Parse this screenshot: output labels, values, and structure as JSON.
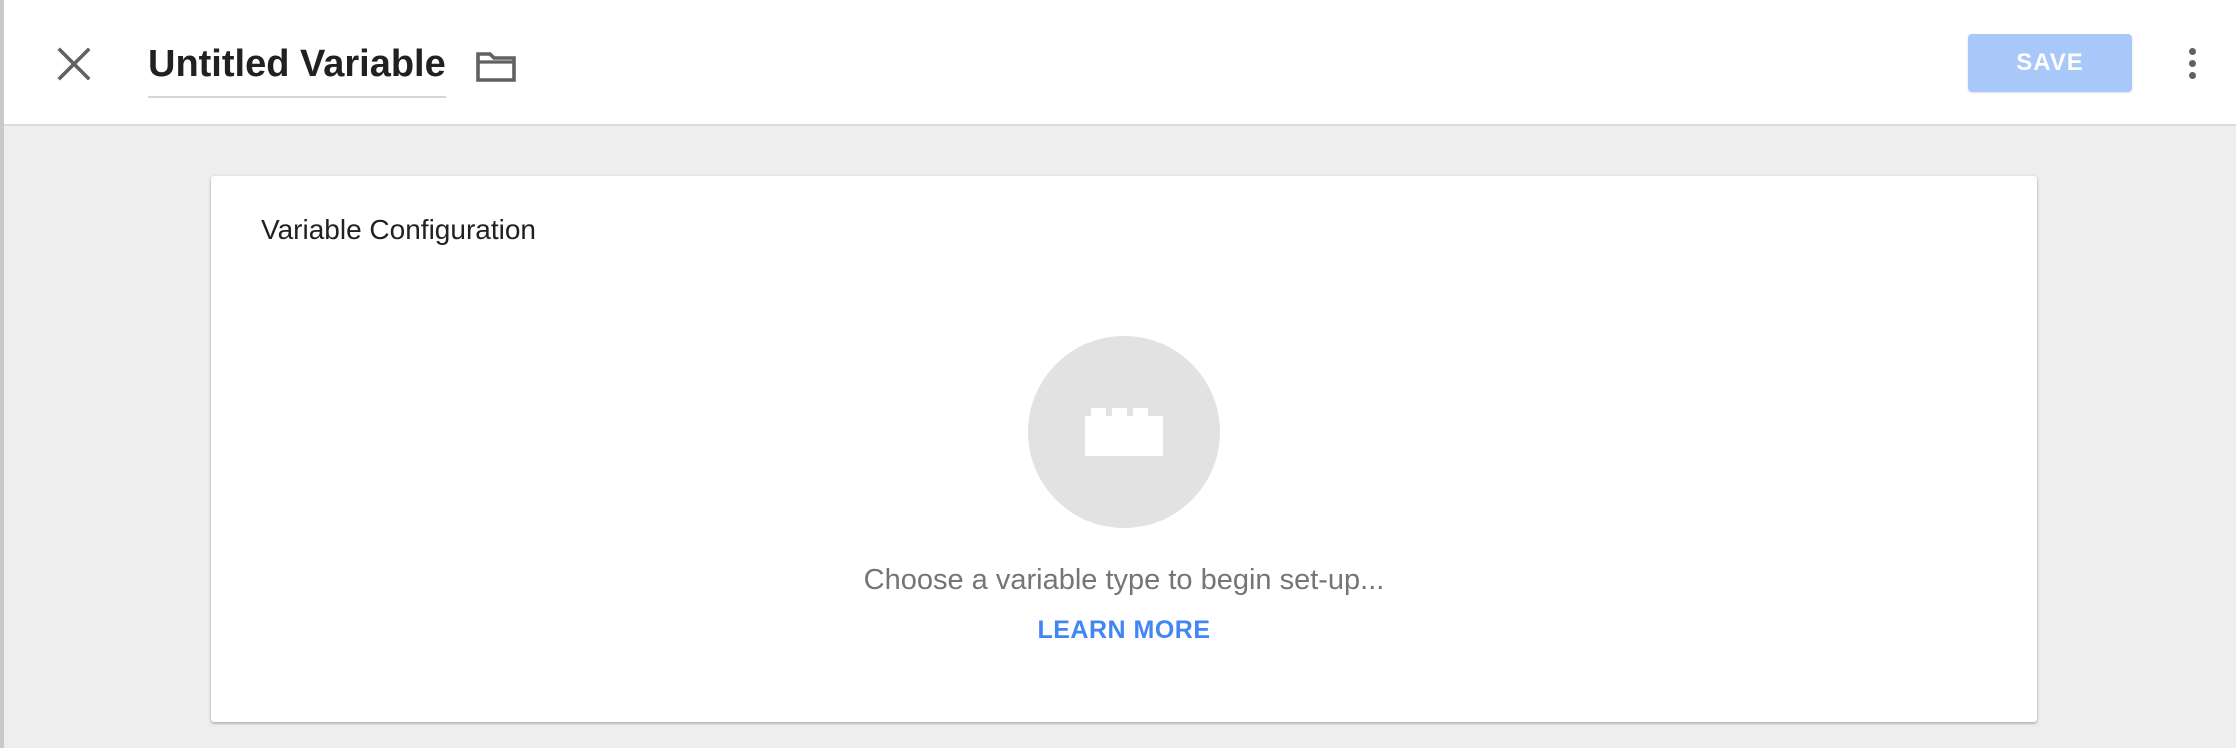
{
  "header": {
    "title": "Untitled Variable",
    "save_label": "SAVE",
    "icons": {
      "close": "close-icon",
      "folder": "folder-icon",
      "more": "more-vert-icon"
    }
  },
  "card": {
    "title": "Variable Configuration",
    "empty_icon": "block-icon",
    "empty_text": "Choose a variable type to begin set-up...",
    "learn_more_label": "LEARN MORE"
  },
  "colors": {
    "accent": "#4285f4",
    "save_disabled": "#a7c8f8",
    "background": "#eeeeee",
    "circle": "#e2e2e2"
  }
}
